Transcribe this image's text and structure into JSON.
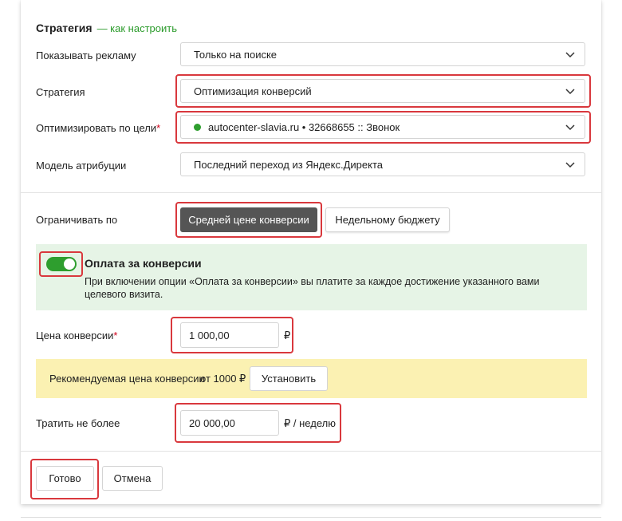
{
  "header": {
    "title": "Стратегия",
    "help_link": "— как настроить"
  },
  "fields": {
    "show_ads": {
      "label": "Показывать рекламу",
      "value": "Только на поиске"
    },
    "strategy": {
      "label": "Стратегия",
      "value": "Оптимизация конверсий"
    },
    "optimize_goal": {
      "label": "Оптимизировать по цели",
      "required_mark": "*",
      "value": "autocenter-slavia.ru • 32668655 :: Звонок"
    },
    "attribution": {
      "label": "Модель атрибуции",
      "value": "Последний переход из Яндекс.Директа"
    }
  },
  "limit": {
    "label": "Ограничивать по",
    "options": [
      "Средней цене конверсии",
      "Недельному бюджету"
    ],
    "selected": "Средней цене конверсии"
  },
  "pay_for_conversions": {
    "enabled": true,
    "title": "Оплата за конверсии",
    "description": "При включении опции «Оплата за конверсии» вы платите за каждое достижение указанного вами целевого визита."
  },
  "conversion_price": {
    "label": "Цена конверсии",
    "required_mark": "*",
    "value": "1 000,00",
    "currency": "₽"
  },
  "recommendation": {
    "text": "Рекомендуемая цена конверсии",
    "amount": "от 1000 ₽",
    "button": "Установить"
  },
  "weekly_spend": {
    "label": "Тратить не более",
    "value": "20 000,00",
    "unit": "₽ / неделю"
  },
  "footer": {
    "done": "Готово",
    "cancel": "Отмена"
  },
  "colors": {
    "accent_green": "#2e9e2e",
    "highlight_red": "#d9383d",
    "selected_dark": "#555555",
    "green_bg": "#e6f4e6",
    "yellow_bg": "#fbf1b2"
  }
}
